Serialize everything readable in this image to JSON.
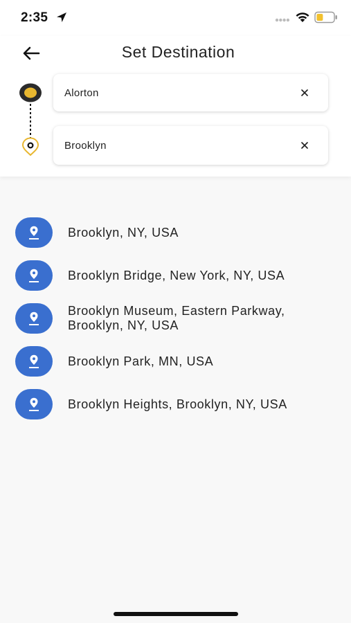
{
  "status_bar": {
    "time": "2:35",
    "icons": [
      "location-arrow-icon",
      "cellular-signal-icon",
      "wifi-icon",
      "battery-icon"
    ],
    "battery_color": "#f2c12e"
  },
  "header": {
    "title": "Set Destination",
    "back_icon": "arrow-left-icon"
  },
  "route": {
    "origin": {
      "value": "Alorton",
      "clear_icon": "close-icon"
    },
    "destination": {
      "value": "Brooklyn",
      "clear_icon": "close-icon"
    },
    "origin_color": "#e8b730",
    "destination_color": "#e8b730"
  },
  "suggestions": [
    {
      "label": "Brooklyn, NY, USA",
      "icon": "location-pin-icon"
    },
    {
      "label": "Brooklyn Bridge, New York, NY, USA",
      "icon": "location-pin-icon"
    },
    {
      "label": "Brooklyn Museum, Eastern Parkway, Brooklyn, NY, USA",
      "icon": "location-pin-icon"
    },
    {
      "label": "Brooklyn Park, MN, USA",
      "icon": "location-pin-icon"
    },
    {
      "label": "Brooklyn Heights, Brooklyn, NY, USA",
      "icon": "location-pin-icon"
    }
  ],
  "colors": {
    "accent_blue": "#3a6fcf",
    "accent_yellow": "#e8b730",
    "background": "#f8f8f8"
  }
}
